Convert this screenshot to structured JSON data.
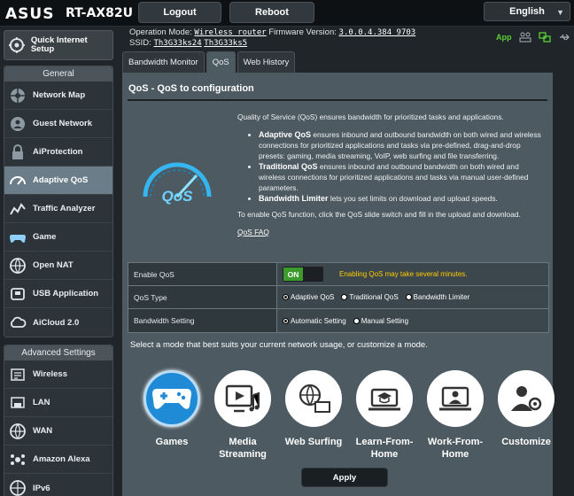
{
  "header": {
    "brand": "ASUS",
    "model": "RT-AX82U",
    "logout_label": "Logout",
    "reboot_label": "Reboot",
    "language": "English"
  },
  "info": {
    "operation_mode_label": "Operation Mode:",
    "operation_mode": "Wireless router",
    "firmware_label": "Firmware Version:",
    "firmware": "3.0.0.4.384_9703",
    "ssid_label": "SSID:",
    "ssid_1": "Th3G33ks24",
    "ssid_2": "Th3G33ks5",
    "app_label": "App"
  },
  "sidebar": {
    "quick_setup": "Quick Internet Setup",
    "general_header": "General",
    "general_items": [
      {
        "label": "Network Map",
        "icon": "network-map-icon"
      },
      {
        "label": "Guest Network",
        "icon": "guest-network-icon"
      },
      {
        "label": "AiProtection",
        "icon": "lock-icon"
      },
      {
        "label": "Adaptive QoS",
        "icon": "speedometer-icon"
      },
      {
        "label": "Traffic Analyzer",
        "icon": "traffic-chart-icon"
      },
      {
        "label": "Game",
        "icon": "gamepad-icon"
      },
      {
        "label": "Open NAT",
        "icon": "open-nat-icon"
      },
      {
        "label": "USB Application",
        "icon": "usb-icon"
      },
      {
        "label": "AiCloud 2.0",
        "icon": "cloud-icon"
      }
    ],
    "advanced_header": "Advanced Settings",
    "advanced_items": [
      {
        "label": "Wireless",
        "icon": "wifi-icon"
      },
      {
        "label": "LAN",
        "icon": "lan-icon"
      },
      {
        "label": "WAN",
        "icon": "globe-icon"
      },
      {
        "label": "Amazon Alexa",
        "icon": "alexa-icon"
      },
      {
        "label": "IPv6",
        "icon": "ipv6-icon"
      }
    ]
  },
  "tabs": [
    "Bandwidth Monitor",
    "QoS",
    "Web History"
  ],
  "panel": {
    "title": "QoS - QoS to configuration",
    "intro": "Quality of Service (QoS) ensures bandwidth for prioritized tasks and applications.",
    "bullets": [
      {
        "term": "Adaptive QoS",
        "text": " ensures inbound and outbound bandwidth on both wired and wireless connections for prioritized applications and tasks via pre-defined, drag-and-drop presets: gaming, media streaming, VoIP, web surfing and file transferring."
      },
      {
        "term": "Traditional QoS",
        "text": " ensures inbound and outbound bandwidth on both wired and wireless connections for prioritized applications and tasks via manual user-defined parameters."
      },
      {
        "term": "Bandwidth Limiter",
        "text": " lets you set limits on download and upload speeds."
      }
    ],
    "enable_hint": "To enable QoS function, click the QoS slide switch and fill in the upload and download.",
    "faq_label": "QoS FAQ",
    "logo_text": "QoS"
  },
  "settings": {
    "enable_label": "Enable QoS",
    "toggle_label": "ON",
    "toggle_state": true,
    "enable_warning": "Enabling QoS may take several minutes.",
    "type_label": "QoS Type",
    "type_options": [
      "Adaptive QoS",
      "Traditional QoS",
      "Bandwidth Limiter"
    ],
    "type_selected": "Adaptive QoS",
    "bandwidth_label": "Bandwidth Setting",
    "bandwidth_options": [
      "Automatic Setting",
      "Manual Setting"
    ],
    "bandwidth_selected": "Automatic Setting"
  },
  "modes": {
    "prompt": "Select a mode that best suits your current network usage, or customize a mode.",
    "items": [
      {
        "label": "Games",
        "icon": "gamepad-icon",
        "selected": true
      },
      {
        "label": "Media Streaming",
        "icon": "media-streaming-icon",
        "selected": false
      },
      {
        "label": "Web Surfing",
        "icon": "web-surfing-icon",
        "selected": false
      },
      {
        "label": "Learn-From-Home",
        "icon": "learn-from-home-icon",
        "selected": false
      },
      {
        "label": "Work-From-Home",
        "icon": "work-from-home-icon",
        "selected": false
      },
      {
        "label": "Customize",
        "icon": "customize-icon",
        "selected": false
      }
    ],
    "apply_label": "Apply"
  },
  "colors": {
    "accent_blue": "#1f8ad6",
    "toggle_on": "#3c9b2a",
    "warning": "#ffcc00",
    "app_green": "#5ccf34"
  }
}
